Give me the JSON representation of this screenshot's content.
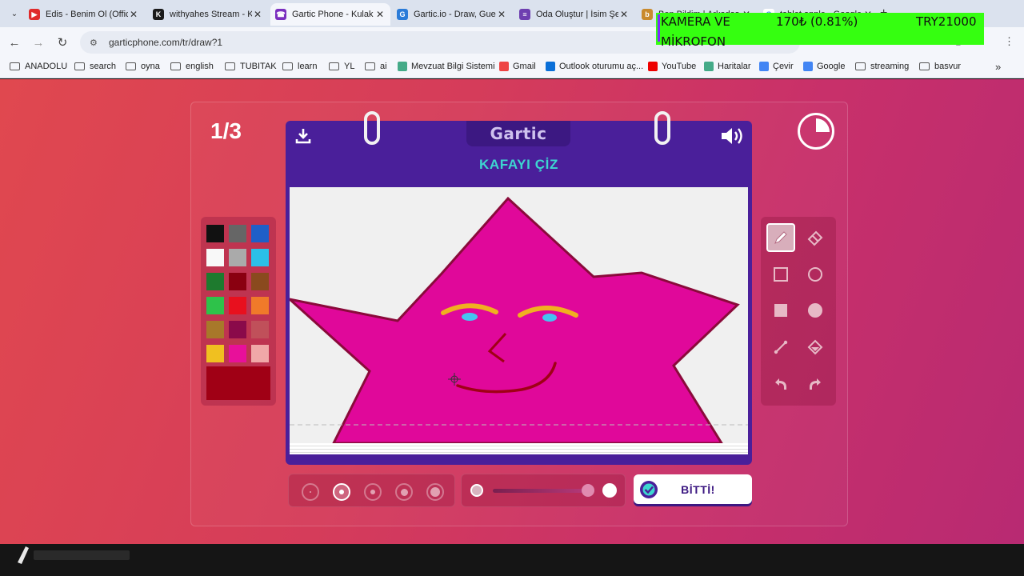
{
  "browser": {
    "tabs": [
      {
        "title": "Edis - Benim Ol (Offic",
        "fav_color": "#e02b2b",
        "fav_glyph": "▶"
      },
      {
        "title": "withyahes Stream - K",
        "fav_color": "#1a1a1a",
        "fav_glyph": "K"
      },
      {
        "title": "Gartic Phone - Kulak",
        "fav_color": "#7b2fbf",
        "fav_glyph": "☎"
      },
      {
        "title": "Gartic.io - Draw, Gue",
        "fav_color": "#2a7bd8",
        "fav_glyph": "G"
      },
      {
        "title": "Oda Oluştur | İsim Şe",
        "fav_color": "#6e3fb0",
        "fav_glyph": "≡"
      },
      {
        "title": "Ben Bildim | Arkadaş",
        "fav_color": "#c98a2d",
        "fav_glyph": "b"
      },
      {
        "title": "tablet apple - Google",
        "fav_color": "#ffffff",
        "fav_glyph": "G"
      }
    ],
    "url": "garticphone.com/tr/draw?1",
    "bookmarks": [
      "ANADOLU",
      "search",
      "oyna",
      "english",
      "TUBITAK",
      "learn",
      "YL",
      "ai",
      "Mevzuat Bilgi Sistemi",
      "Gmail",
      "Outlook oturumu aç...",
      "YouTube",
      "Haritalar",
      "Çevir",
      "Google",
      "streaming",
      "basvur"
    ]
  },
  "overlay": {
    "line1": "KAMERA VE",
    "line2": "MİKROFON",
    "price": "170₺ (0.81%)",
    "total": "TRY21000"
  },
  "game": {
    "round": "1/3",
    "logo": "Gartic",
    "prompt": "KAFAYI ÇİZ",
    "done_label": "BİTTİ!"
  },
  "palette": [
    "#111111",
    "#666666",
    "#1f5fc8",
    "#f8f8f8",
    "#aaaaaa",
    "#2bc0e8",
    "#1e7a2e",
    "#8a0010",
    "#8a4a1e",
    "#2ec24a",
    "#e8101e",
    "#f07a2a",
    "#a8782a",
    "#8a0a4a",
    "#c0505a",
    "#f0c020",
    "#e8109a",
    "#f0a8a8"
  ],
  "current_color": "#a00015",
  "drawing_colors": {
    "star": "#e0089a",
    "outline": "#8a0a3a",
    "brows": "#f0b020",
    "eyes": "#44c4f0",
    "mouth": "#a00015"
  }
}
